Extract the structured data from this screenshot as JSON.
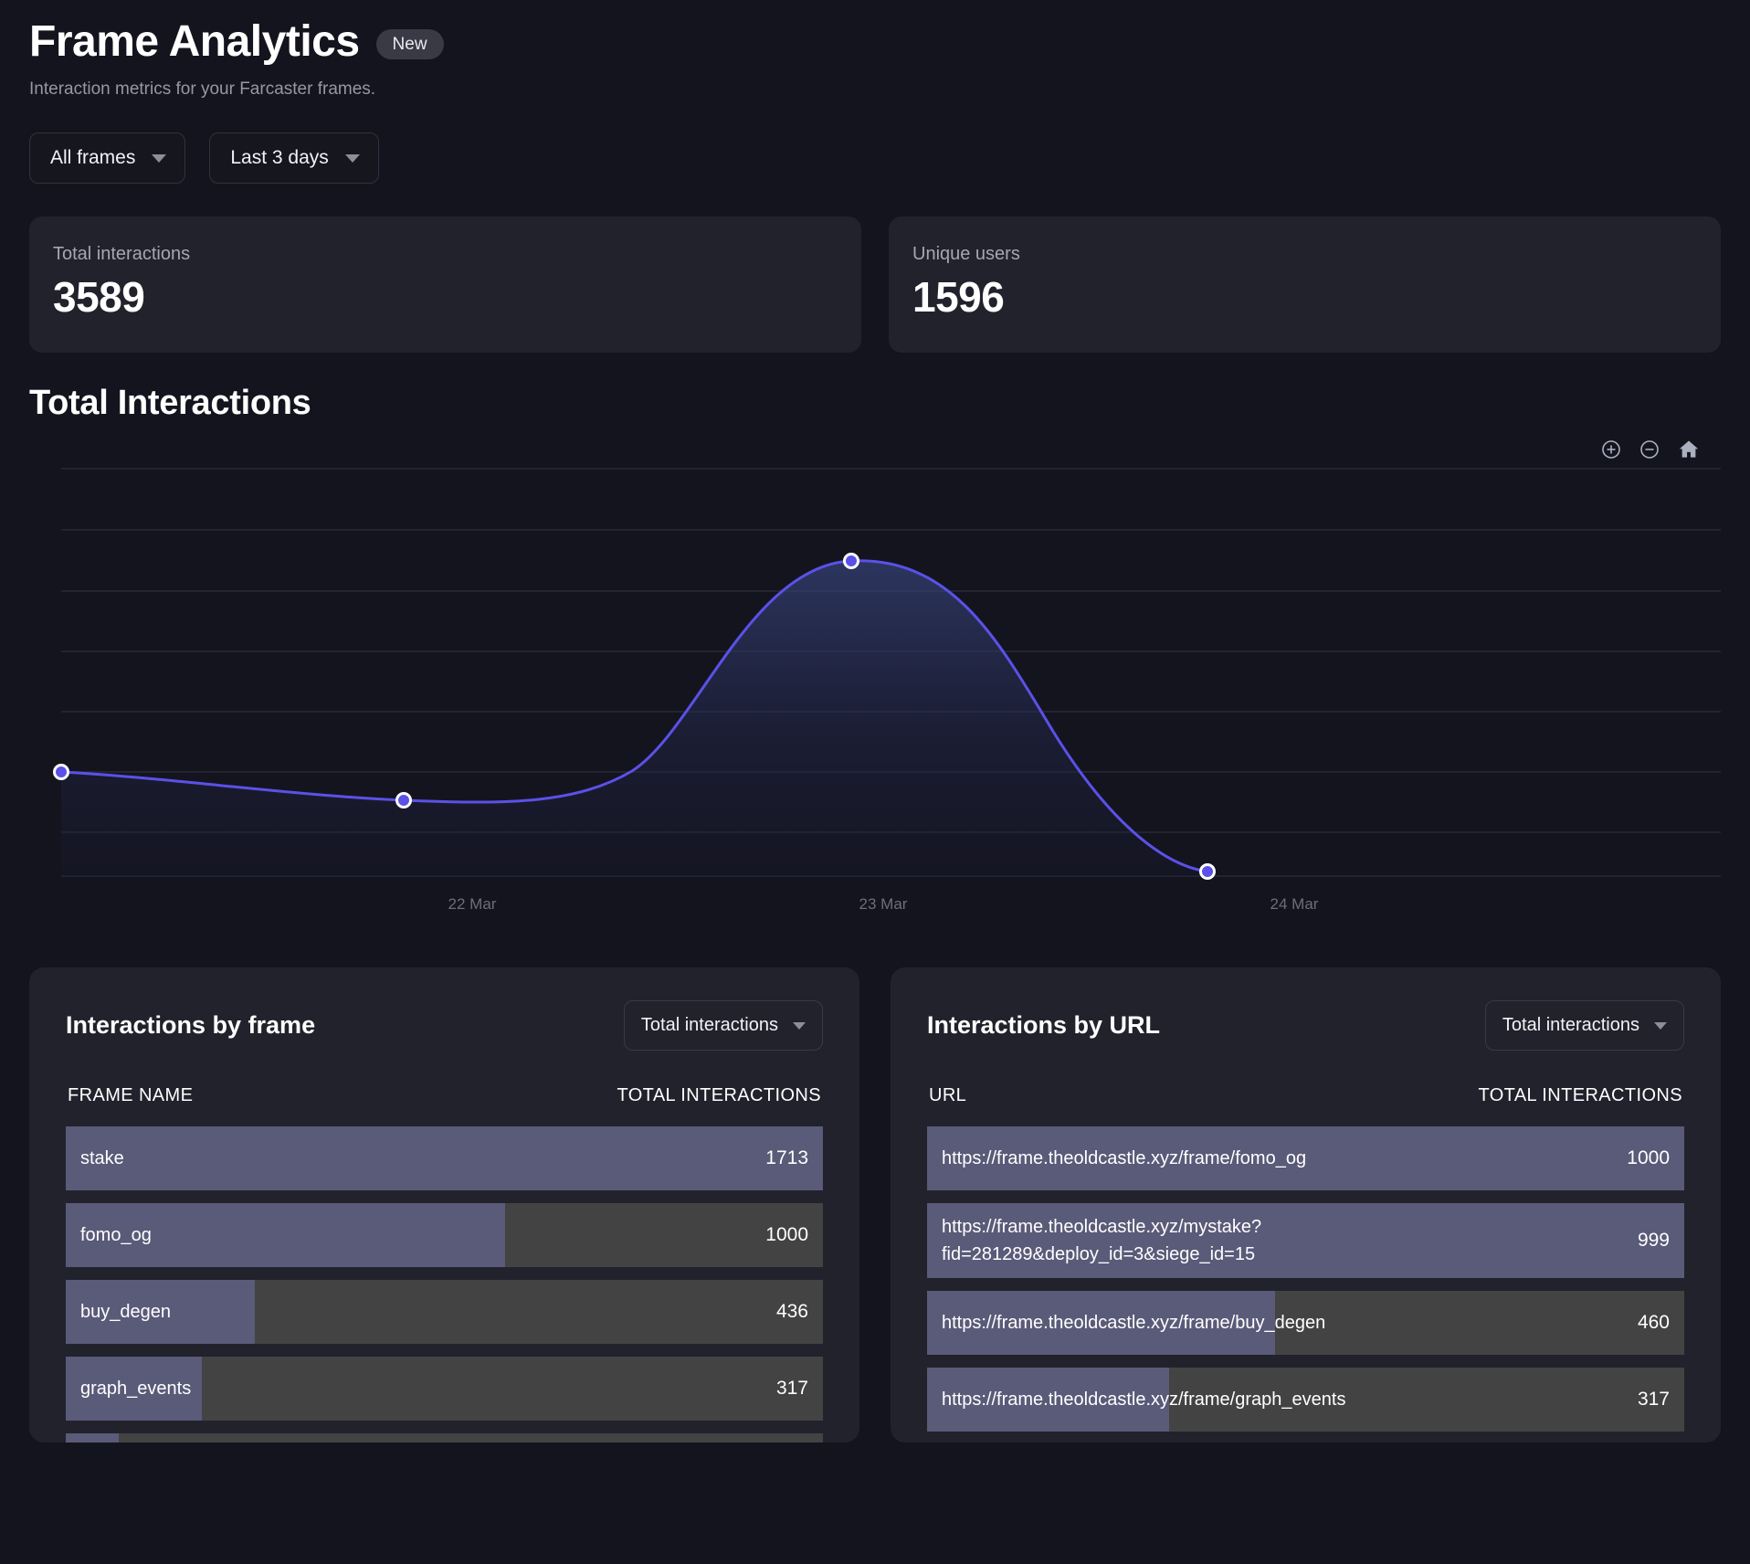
{
  "header": {
    "title": "Frame Analytics",
    "badge": "New",
    "subtitle": "Interaction metrics for your Farcaster frames."
  },
  "filters": {
    "frame_filter": "All frames",
    "range_filter": "Last 3 days"
  },
  "stats": [
    {
      "label": "Total interactions",
      "value": "3589"
    },
    {
      "label": "Unique users",
      "value": "1596"
    }
  ],
  "chart_section": {
    "title": "Total Interactions",
    "tools": [
      {
        "name": "zoom-in-icon",
        "glyph": "plus-circle"
      },
      {
        "name": "zoom-out-icon",
        "glyph": "minus-circle"
      },
      {
        "name": "reset-home-icon",
        "glyph": "home"
      }
    ]
  },
  "chart_data": {
    "type": "line",
    "title": "Total Interactions",
    "xlabel": "",
    "ylabel": "",
    "grid": true,
    "legend": false,
    "x": [
      "22 Mar",
      "23 Mar",
      "24 Mar"
    ],
    "tick_labels": [
      "22 Mar",
      "23 Mar",
      "24 Mar"
    ],
    "points": [
      {
        "x": 0.0,
        "y": 840
      },
      {
        "x": 0.82,
        "y": 800
      },
      {
        "x": 1.63,
        "y": 1745
      },
      {
        "x": 2.45,
        "y": 520
      }
    ],
    "series": [
      {
        "name": "Total interactions",
        "values": [
          840,
          800,
          1745,
          520
        ],
        "color": "#5b51e8"
      }
    ],
    "ylim": [
      0,
      2000
    ],
    "gridline_count": 8,
    "area_fill": true
  },
  "frames_panel": {
    "title": "Interactions by frame",
    "metric_select": "Total interactions",
    "columns": [
      "FRAME NAME",
      "TOTAL INTERACTIONS"
    ],
    "rows": [
      {
        "label": "stake",
        "value": "1713",
        "pct": 100
      },
      {
        "label": "fomo_og",
        "value": "1000",
        "pct": 58
      },
      {
        "label": "buy_degen",
        "value": "436",
        "pct": 25
      },
      {
        "label": "graph_events",
        "value": "317",
        "pct": 18
      },
      {
        "label": "",
        "value": "",
        "pct": 7
      }
    ]
  },
  "urls_panel": {
    "title": "Interactions by URL",
    "metric_select": "Total interactions",
    "columns": [
      "URL",
      "TOTAL INTERACTIONS"
    ],
    "rows": [
      {
        "label": "https://frame.theoldcastle.xyz/frame/fomo_og",
        "value": "1000",
        "pct": 100,
        "tall": false
      },
      {
        "label": "https://frame.theoldcastle.xyz/mystake?fid=281289&deploy_id=3&siege_id=15",
        "value": "999",
        "pct": 100,
        "tall": true
      },
      {
        "label": "https://frame.theoldcastle.xyz/frame/buy_degen",
        "value": "460",
        "pct": 46,
        "tall": false
      },
      {
        "label": "https://frame.theoldcastle.xyz/frame/graph_events",
        "value": "317",
        "pct": 32,
        "tall": false
      }
    ]
  },
  "colors": {
    "background": "#14141f",
    "card": "#22222d",
    "accent_line": "#5b51e8",
    "bar_fill": "#5a5a79",
    "bar_track": "#434343"
  }
}
